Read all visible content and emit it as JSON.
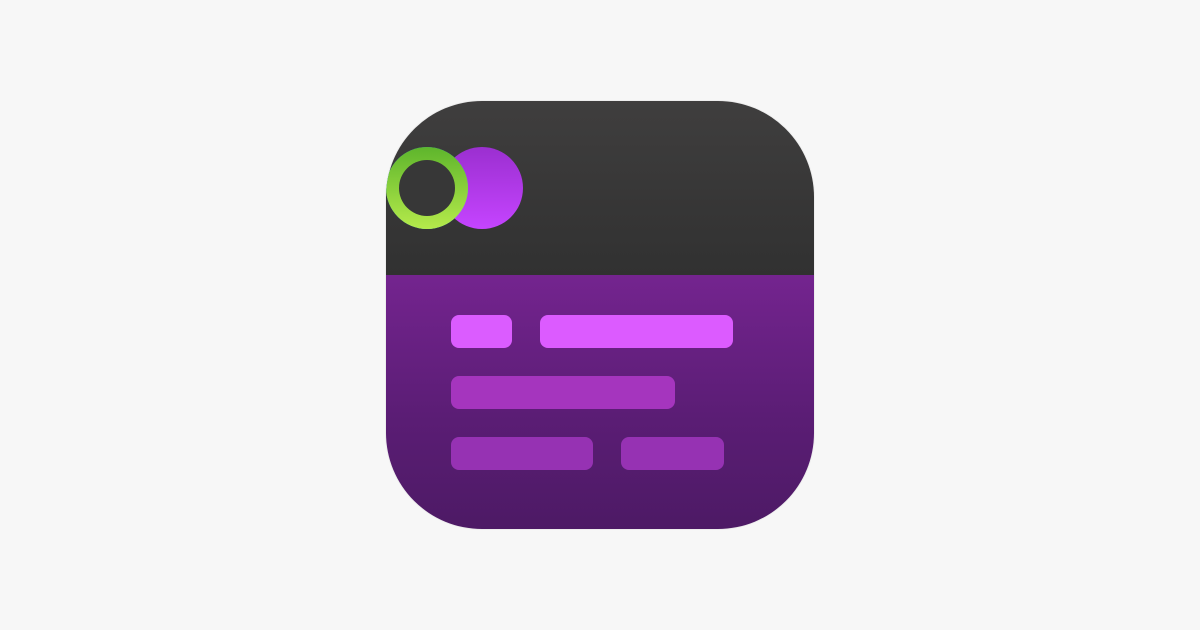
{
  "app_icon": {
    "icon": "window-list-app-icon",
    "colors": {
      "background": "#f7f7f7",
      "header": "#3a3a3a",
      "body": "#5e1f78",
      "dot_purple": "#c544ff",
      "ring_blue": "#2ad2ff",
      "ring_green": "#8fdc3f",
      "bar_bright": "#dc5bff",
      "bar_muted": "#9a33b6"
    },
    "header_dots": [
      "filled-purple-dot-icon",
      "blue-ring-icon",
      "green-ring-icon"
    ]
  }
}
